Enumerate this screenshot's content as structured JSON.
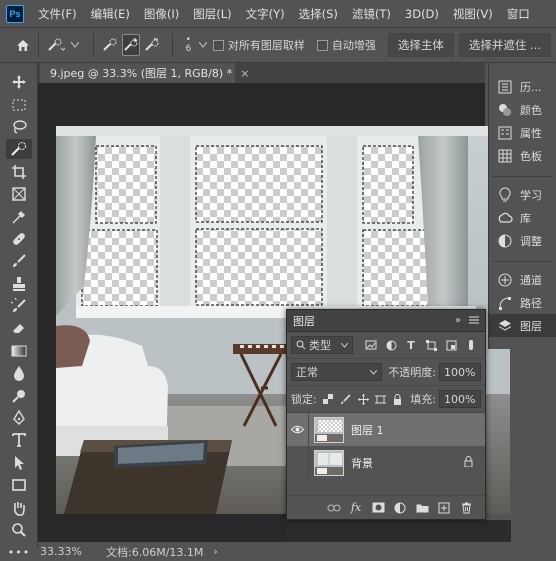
{
  "app": {
    "logo": "Ps",
    "brand_color": "#31a8ff"
  },
  "menu": [
    "文件(F)",
    "编辑(E)",
    "图像(I)",
    "图层(L)",
    "文字(Y)",
    "选择(S)",
    "滤镜(T)",
    "3D(D)",
    "视图(V)",
    "窗口"
  ],
  "options_bar": {
    "brush_size": "6",
    "sample_all_layers": "对所有图层取样",
    "auto_enhance": "自动增强",
    "select_subject": "选择主体",
    "select_and_mask": "选择并遮住 ..."
  },
  "document": {
    "tab_title": "9.jpeg @ 33.3% (图层 1, RGB/8) *",
    "close": "×"
  },
  "status": {
    "zoom": "33.33%",
    "doc_size": "文档:6.06M/13.1M",
    "arrow": "›"
  },
  "dock": {
    "group1": [
      {
        "label": "历...",
        "icon": "history-icon"
      },
      {
        "label": "颜色",
        "icon": "color-icon"
      },
      {
        "label": "属性",
        "icon": "properties-icon"
      },
      {
        "label": "色板",
        "icon": "swatches-icon"
      }
    ],
    "group2": [
      {
        "label": "学习",
        "icon": "learn-icon"
      },
      {
        "label": "库",
        "icon": "libraries-icon"
      },
      {
        "label": "调整",
        "icon": "adjustments-icon"
      }
    ],
    "group3": [
      {
        "label": "通道",
        "icon": "channels-icon"
      },
      {
        "label": "路径",
        "icon": "paths-icon"
      },
      {
        "label": "图层",
        "icon": "layers-icon"
      }
    ]
  },
  "layers_panel": {
    "title": "图层",
    "filter_type": "类型",
    "blend_mode": "正常",
    "opacity_label": "不透明度:",
    "opacity_value": "100%",
    "lock_label": "锁定:",
    "fill_label": "填充:",
    "fill_value": "100%",
    "layers": [
      {
        "name": "图层 1",
        "selected": true,
        "visible": true,
        "locked": false
      },
      {
        "name": "背景",
        "selected": false,
        "visible": false,
        "locked": true
      }
    ]
  }
}
